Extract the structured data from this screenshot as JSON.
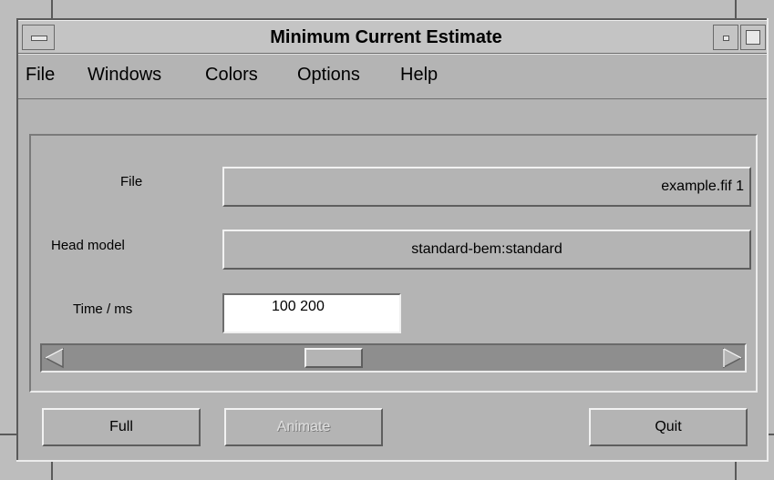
{
  "window": {
    "title": "Minimum Current Estimate"
  },
  "menubar": {
    "items": [
      {
        "label": "File"
      },
      {
        "label": "Windows"
      },
      {
        "label": "Colors"
      },
      {
        "label": "Options"
      },
      {
        "label": "Help"
      }
    ]
  },
  "form": {
    "file": {
      "label": "File",
      "value": "example.fif 1"
    },
    "head_model": {
      "label": "Head model",
      "value": "standard-bem:standard"
    },
    "time": {
      "label": "Time / ms",
      "value": "100 200"
    }
  },
  "scrollbar": {
    "position_fraction": 0.4
  },
  "buttons": {
    "full": "Full",
    "animate": "Animate",
    "quit": "Quit"
  },
  "icons": {
    "window_menu": "window-menu-icon",
    "minimize": "minimize-icon",
    "maximize": "maximize-icon",
    "scroll_left": "left-arrow-icon",
    "scroll_right": "right-arrow-icon"
  }
}
